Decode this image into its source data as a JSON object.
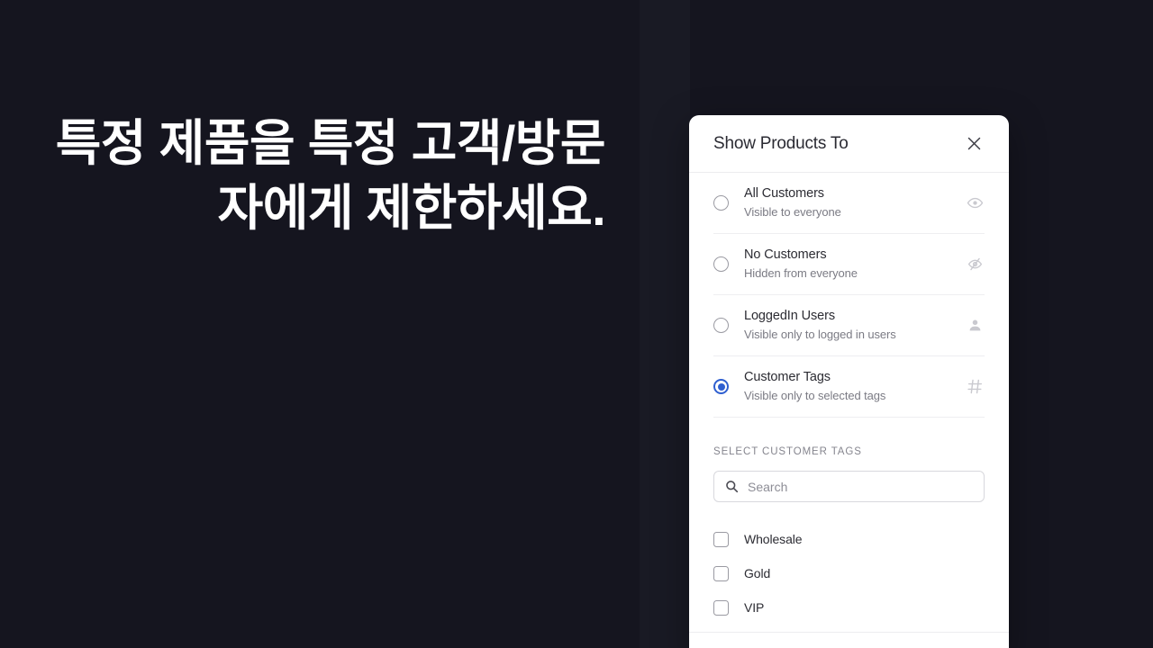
{
  "background": {
    "color": "#15151f",
    "headline": "특정 제품을 특정 고객/방문자에게 제한하세요."
  },
  "modal": {
    "title": "Show Products To",
    "close_icon": "close-icon",
    "accent_color": "#2f5fd0",
    "options": [
      {
        "title": "All Customers",
        "subtitle": "Visible to everyone",
        "icon": "eye-icon",
        "selected": false
      },
      {
        "title": "No Customers",
        "subtitle": "Hidden from everyone",
        "icon": "eye-off-icon",
        "selected": false
      },
      {
        "title": "LoggedIn Users",
        "subtitle": "Visible only to logged in users",
        "icon": "person-icon",
        "selected": false
      },
      {
        "title": "Customer Tags",
        "subtitle": "Visible only to selected tags",
        "icon": "hash-icon",
        "selected": true
      }
    ],
    "tags_section": {
      "label": "SELECT CUSTOMER TAGS",
      "search": {
        "icon": "search-icon",
        "value": "",
        "placeholder": "Search"
      },
      "tags": [
        {
          "label": "Wholesale",
          "checked": false
        },
        {
          "label": "Gold",
          "checked": false
        },
        {
          "label": "VIP",
          "checked": false
        }
      ]
    }
  }
}
